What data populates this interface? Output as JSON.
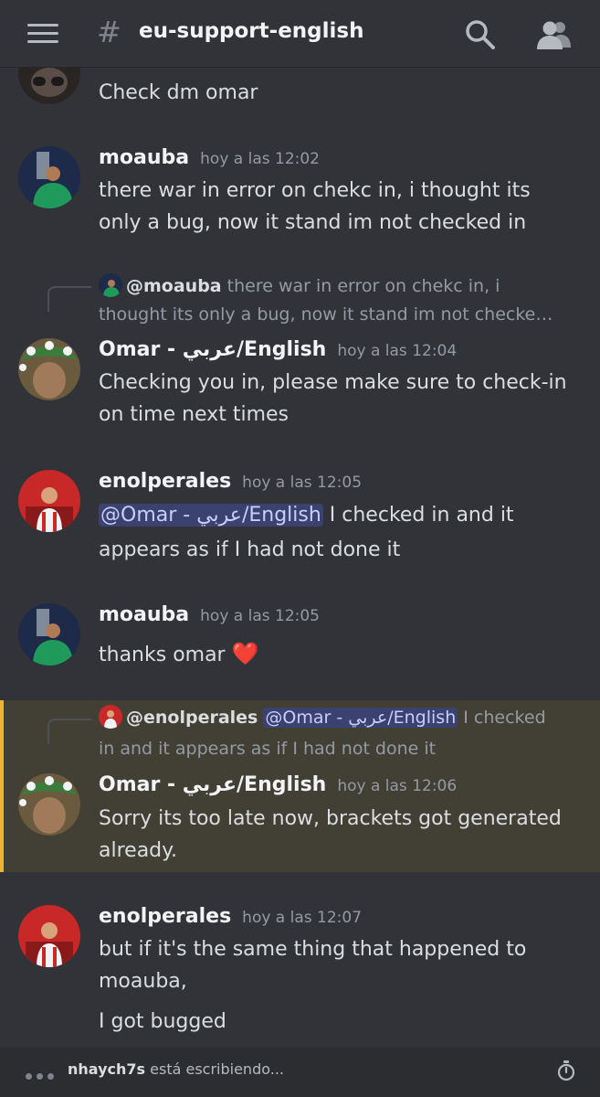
{
  "header": {
    "channel_name": "eu-support-english",
    "hash_glyph": "#",
    "icons": [
      "hamburger-menu-icon",
      "search-icon",
      "members-icon"
    ]
  },
  "messages": [
    {
      "text": "Check dm omar"
    },
    {
      "author": "moauba",
      "time": "hoy a las 12:02",
      "lines": [
        "there war in error on chekc in, i thought its",
        "only a bug, now it stand im not checked in"
      ]
    },
    {
      "reply": {
        "author": "@moauba",
        "lines": [
          "there war in error on chekc in, i",
          "thought its only a bug, now it stand im not checke…"
        ]
      },
      "author": "Omar - عربي/English",
      "time": "hoy a las 12:04",
      "lines": [
        "Checking you in, please make sure to check-in",
        "on time next times"
      ]
    },
    {
      "author": "enolperales",
      "time": "hoy a las 12:05",
      "mention": "@Omar - عربي/English",
      "line1_rest": " I checked in and it",
      "line2": "appears as if I had not done it"
    },
    {
      "author": "moauba",
      "time": "hoy a las 12:05",
      "text": "thanks omar",
      "emoji": "❤️"
    },
    {
      "reply": {
        "author": "@enolperales",
        "mention": "@Omar - عربي/English",
        "line1_rest": " I checked",
        "line2": "in and it appears as if I had not done it"
      },
      "author": "Omar - عربي/English",
      "time": "hoy a las 12:06",
      "lines": [
        "Sorry its too late now, brackets got generated",
        "already."
      ]
    },
    {
      "author": "enolperales",
      "time": "hoy a las 12:07",
      "lines": [
        "but if it's the same thing that happened to",
        "moauba,"
      ],
      "followup": "I got bugged"
    }
  ],
  "typing": {
    "user": "nhaych7s",
    "status": " está escribiendo..."
  },
  "colors": {
    "background": "#313338",
    "mention_bg": "#3c4270",
    "highlight_bg": "#423f35",
    "highlight_bar": "#f0b232"
  }
}
